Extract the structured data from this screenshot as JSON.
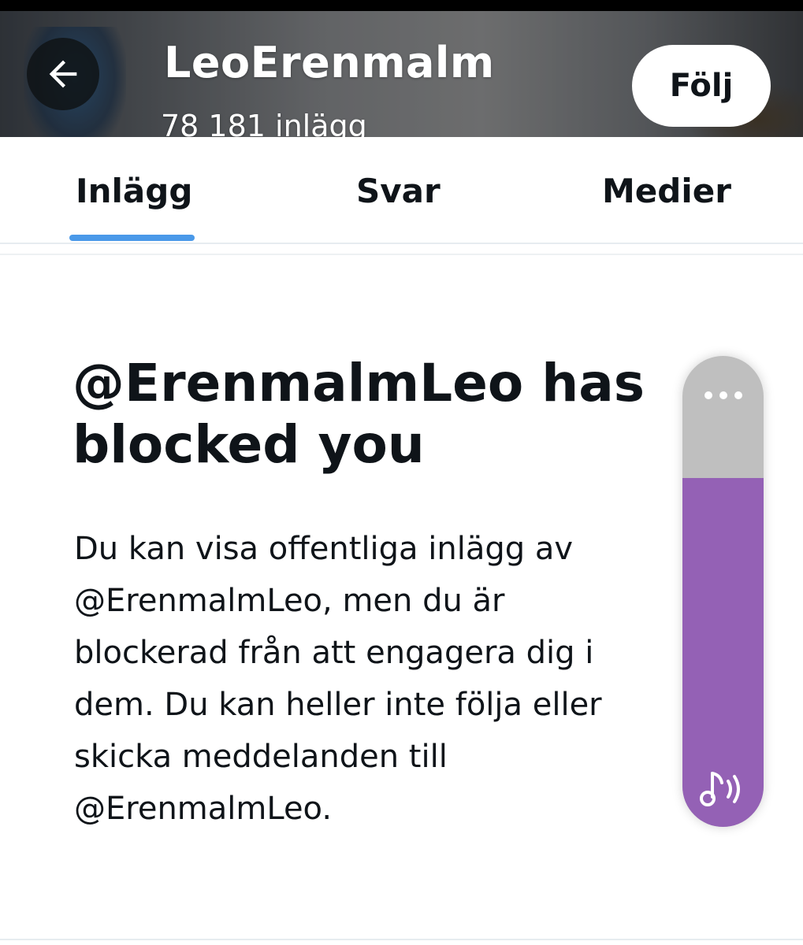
{
  "header": {
    "title": "LeoErenmalm",
    "subtitle": "78 181 inlägg",
    "follow_label": "Följ",
    "back_icon": "arrow-left-icon"
  },
  "tabs": [
    {
      "label": "Inlägg",
      "active": true
    },
    {
      "label": "Svar",
      "active": false
    },
    {
      "label": "Medier",
      "active": false
    }
  ],
  "blocked": {
    "title": "@ErenmalmLeo has blocked you",
    "body": "Du kan visa offentliga inlägg av @ErenmalmLeo, men du är blockerad från att engagera dig i dem. Du kan heller inte följa eller skicka meddelanden till @ErenmalmLeo."
  },
  "volume_overlay": {
    "level_fraction": 0.74,
    "more_icon": "more-dots-icon",
    "media_icon": "music-volume-icon"
  },
  "colors": {
    "accent_tab_indicator": "#4a99e9",
    "volume_fill": "#9461b5",
    "volume_track": "#bfbfbf",
    "text_primary": "#0f1419"
  }
}
